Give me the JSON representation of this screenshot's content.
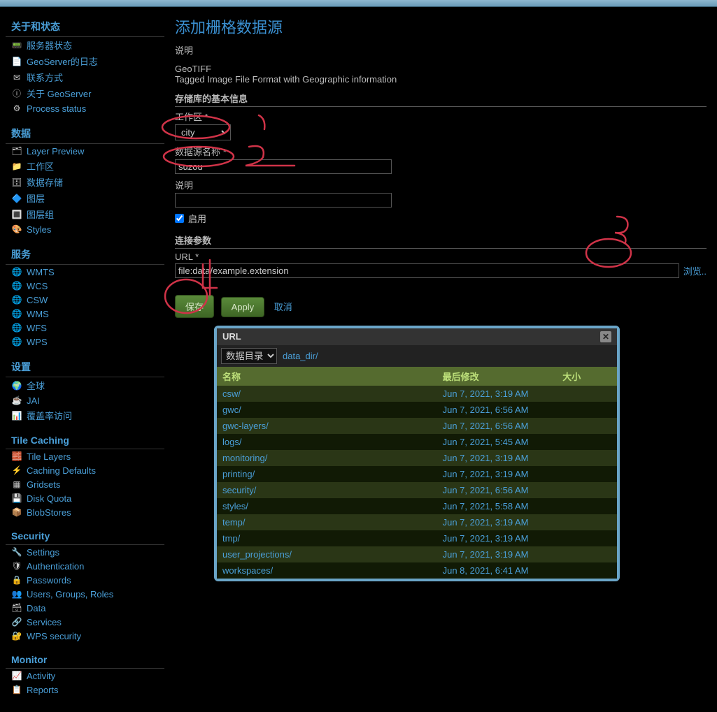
{
  "sidebar": {
    "groups": [
      {
        "title": "关于和状态",
        "items": [
          {
            "icon": "📟",
            "label": "服务器状态"
          },
          {
            "icon": "📄",
            "label": "GeoServer的日志"
          },
          {
            "icon": "✉",
            "label": "联系方式"
          },
          {
            "icon": "ⓘ",
            "label": "关于 GeoServer"
          },
          {
            "icon": "⚙",
            "label": "Process status"
          }
        ]
      },
      {
        "title": "数据",
        "items": [
          {
            "icon": "🗂",
            "label": "Layer Preview"
          },
          {
            "icon": "📁",
            "label": "工作区"
          },
          {
            "icon": "🗄",
            "label": "数据存储"
          },
          {
            "icon": "🔷",
            "label": "图层"
          },
          {
            "icon": "🔳",
            "label": "图层组"
          },
          {
            "icon": "🎨",
            "label": "Styles"
          }
        ]
      },
      {
        "title": "服务",
        "items": [
          {
            "icon": "🌐",
            "label": "WMTS"
          },
          {
            "icon": "🌐",
            "label": "WCS"
          },
          {
            "icon": "🌐",
            "label": "CSW"
          },
          {
            "icon": "🌐",
            "label": "WMS"
          },
          {
            "icon": "🌐",
            "label": "WFS"
          },
          {
            "icon": "🌐",
            "label": "WPS"
          }
        ]
      },
      {
        "title": "设置",
        "items": [
          {
            "icon": "🌍",
            "label": "全球"
          },
          {
            "icon": "☕",
            "label": "JAI"
          },
          {
            "icon": "📊",
            "label": "覆盖率访问"
          }
        ]
      },
      {
        "title": "Tile Caching",
        "items": [
          {
            "icon": "🧱",
            "label": "Tile Layers"
          },
          {
            "icon": "⚡",
            "label": "Caching Defaults"
          },
          {
            "icon": "▦",
            "label": "Gridsets"
          },
          {
            "icon": "💾",
            "label": "Disk Quota"
          },
          {
            "icon": "📦",
            "label": "BlobStores"
          }
        ]
      },
      {
        "title": "Security",
        "items": [
          {
            "icon": "🔧",
            "label": "Settings"
          },
          {
            "icon": "🛡",
            "label": "Authentication"
          },
          {
            "icon": "🔒",
            "label": "Passwords"
          },
          {
            "icon": "👥",
            "label": "Users, Groups, Roles"
          },
          {
            "icon": "🗃",
            "label": "Data"
          },
          {
            "icon": "🔗",
            "label": "Services"
          },
          {
            "icon": "🔐",
            "label": "WPS security"
          }
        ]
      },
      {
        "title": "Monitor",
        "items": [
          {
            "icon": "📈",
            "label": "Activity"
          },
          {
            "icon": "📋",
            "label": "Reports"
          }
        ]
      }
    ]
  },
  "page": {
    "title": "添加栅格数据源",
    "desc_label": "说明",
    "format_name": "GeoTIFF",
    "format_desc": "Tagged Image File Format with Geographic information",
    "section_basic": "存储库的基本信息",
    "workspace_label": "工作区 *",
    "workspace_options": [
      "city"
    ],
    "workspace_value": "city",
    "dsname_label": "数据源名称 *",
    "dsname_value": "suzou",
    "desc2_label": "说明",
    "desc2_value": "",
    "enabled_label": "启用",
    "enabled_checked": true,
    "section_conn": "连接参数",
    "url_label": "URL *",
    "url_value": "file:data/example.extension",
    "browse_label": "浏览..",
    "btn_save": "保存",
    "btn_apply": "Apply",
    "btn_cancel": "取消"
  },
  "dialog": {
    "title": "URL",
    "selector_label": "数据目录",
    "breadcrumb": "data_dir/",
    "cols": {
      "name": "名称",
      "modified": "最后修改",
      "size": "大小"
    },
    "rows": [
      {
        "name": "csw/",
        "time": "Jun 7, 2021, 3:19 AM",
        "size": ""
      },
      {
        "name": "gwc/",
        "time": "Jun 7, 2021, 6:56 AM",
        "size": ""
      },
      {
        "name": "gwc-layers/",
        "time": "Jun 7, 2021, 6:56 AM",
        "size": ""
      },
      {
        "name": "logs/",
        "time": "Jun 7, 2021, 5:45 AM",
        "size": ""
      },
      {
        "name": "monitoring/",
        "time": "Jun 7, 2021, 3:19 AM",
        "size": ""
      },
      {
        "name": "printing/",
        "time": "Jun 7, 2021, 3:19 AM",
        "size": ""
      },
      {
        "name": "security/",
        "time": "Jun 7, 2021, 6:56 AM",
        "size": ""
      },
      {
        "name": "styles/",
        "time": "Jun 7, 2021, 5:58 AM",
        "size": ""
      },
      {
        "name": "temp/",
        "time": "Jun 7, 2021, 3:19 AM",
        "size": ""
      },
      {
        "name": "tmp/",
        "time": "Jun 7, 2021, 3:19 AM",
        "size": ""
      },
      {
        "name": "user_projections/",
        "time": "Jun 7, 2021, 3:19 AM",
        "size": ""
      },
      {
        "name": "workspaces/",
        "time": "Jun 8, 2021, 6:41 AM",
        "size": ""
      }
    ]
  }
}
